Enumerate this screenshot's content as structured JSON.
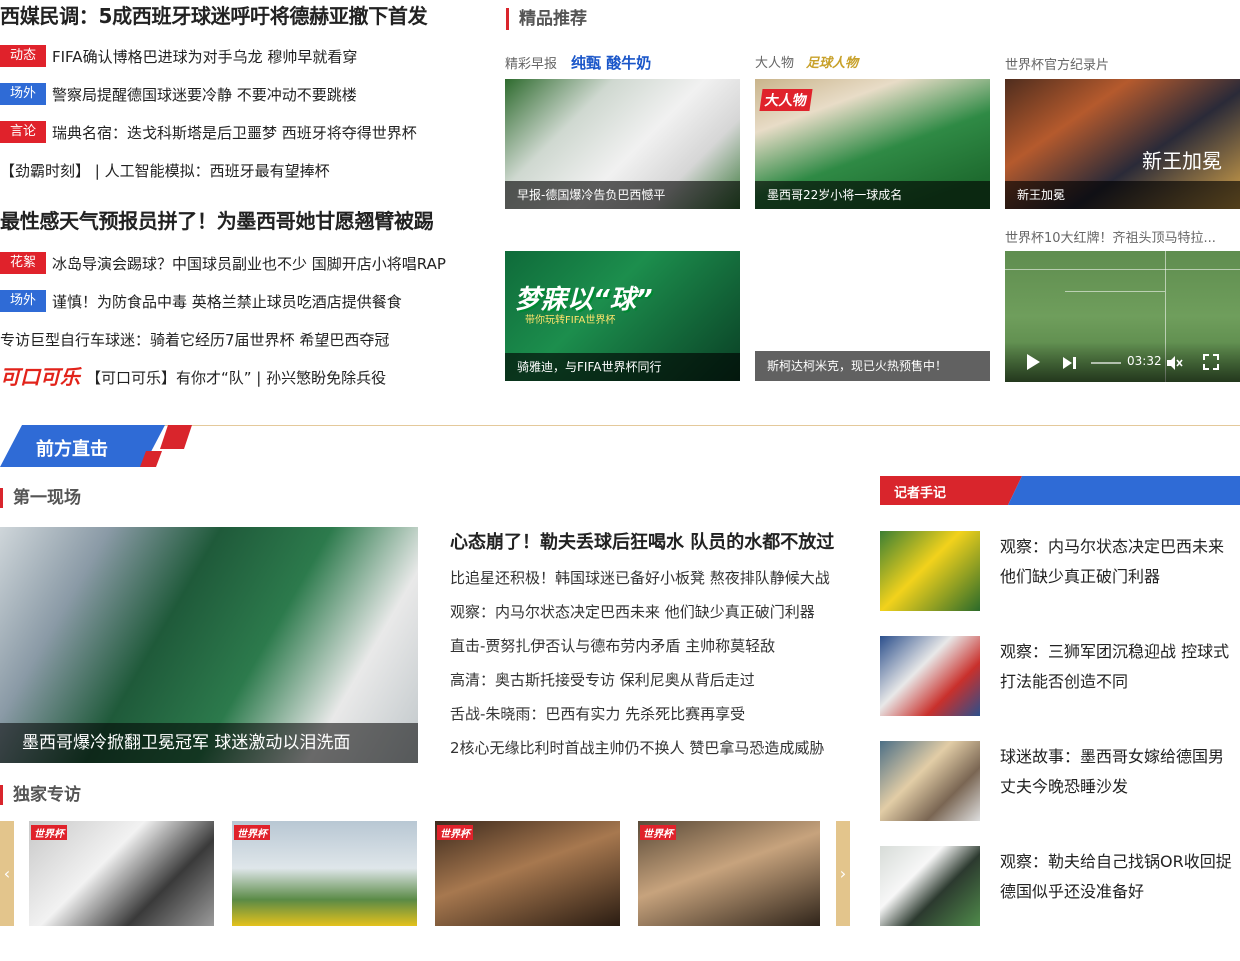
{
  "news": {
    "headline1": "西媒民调：5成西班牙球迷呼吁将德赫亚撤下首发",
    "group1": [
      {
        "tag": "动态",
        "tag_color": "#e0222b",
        "text": "FIFA确认博格巴进球为对手乌龙 穆帅早就看穿"
      },
      {
        "tag": "场外",
        "tag_color": "#2f6bd6",
        "text": "警察局提醒德国球迷要冷静 不要冲动不要跳楼"
      },
      {
        "tag": "言论",
        "tag_color": "#e0222b",
        "text": "瑞典名宿：迭戈科斯塔是后卫噩梦 西班牙将夺得世界杯"
      },
      {
        "tag": "",
        "text": "【劲霸时刻】 | 人工智能模拟：西班牙最有望捧杯"
      }
    ],
    "headline2": "最性感天气预报员拼了！为墨西哥她甘愿翘臂被踢",
    "group2": [
      {
        "tag": "花絮",
        "tag_color": "#e0222b",
        "text": "冰岛导演会踢球？中国球员副业也不少 国脚开店小将唱RAP"
      },
      {
        "tag": "场外",
        "tag_color": "#2f6bd6",
        "text": "谨慎！为防食品中毒 英格兰禁止球员吃酒店提供餐食"
      },
      {
        "tag": "",
        "text": "专访巨型自行车球迷：骑着它经历7届世界杯 希望巴西夺冠"
      }
    ],
    "sponsor_logo": "可口可乐",
    "sponsor_text": "【可口可乐】有你才“队” | 孙兴慜盼免除兵役"
  },
  "recommend": {
    "title": "精品推荐",
    "items": [
      {
        "label": "精彩早报",
        "brand": "纯甄 酸牛奶",
        "caption": "早报-德国爆冷告负巴西憾平"
      },
      {
        "label": "大人物",
        "brand": "足球人物",
        "badge": "大人物",
        "caption": "墨西哥22岁小将一球成名"
      },
      {
        "label": "世界杯官方纪录片",
        "overlay": "新王加冕",
        "caption": "新王加冕"
      },
      {
        "banner": "梦寐以“球”",
        "banner_sub": "带你玩转FIFA世界杯",
        "caption": "骑雅迪，与FIFA世界杯同行"
      },
      {
        "caption": "斯柯达柯米克，现已火热预售中！"
      },
      {
        "label": "世界杯10大红牌！齐祖头顶马特拉...",
        "time": "03:32"
      }
    ]
  },
  "section": {
    "title": "前方直击"
  },
  "scene": {
    "title": "第一现场",
    "image_caption": "墨西哥爆冷掀翻卫冕冠军 球迷激动以泪洗面",
    "headline": "心态崩了！勒夫丢球后狂喝水 队员的水都不放过",
    "links": [
      "比追星还积极！韩国球迷已备好小板凳 熬夜排队静候大战",
      "观察：内马尔状态决定巴西未来 他们缺少真正破门利器",
      "直击-贾努扎伊否认与德布劳内矛盾 主帅称莫轻敌",
      "高清：奥古斯托接受专访 保利尼奥从背后走过",
      "舌战-朱晓雨：巴西有实力 先杀死比赛再享受",
      "2核心无缘比利时首战主帅仍不换人 赞巴拿马恐造成威胁"
    ]
  },
  "exclusive": {
    "title": "独家专访",
    "badge": "世界杯",
    "prev": "‹",
    "next": "›"
  },
  "notes": {
    "title": "记者手记",
    "items": [
      {
        "text": "观察：内马尔状态决定巴西未来 他们缺少真正破门利器"
      },
      {
        "text": "观察：三狮军团沉稳迎战 控球式打法能否创造不同"
      },
      {
        "text": "球迷故事：墨西哥女嫁给德国男 丈夫今晚恐睡沙发"
      },
      {
        "text": "观察：勒夫给自己找锅OR收回捉 德国似乎还没准备好"
      }
    ]
  }
}
